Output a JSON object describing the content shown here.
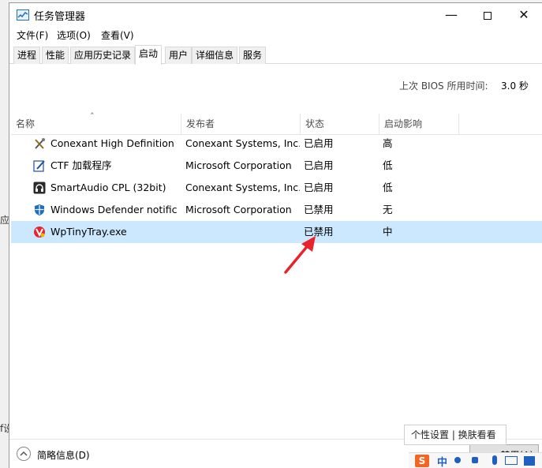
{
  "window": {
    "title": "任务管理器"
  },
  "menu": {
    "file": "文件(F)",
    "options": "选项(O)",
    "view": "查看(V)"
  },
  "tabs": [
    {
      "label": "进程",
      "active": false
    },
    {
      "label": "性能",
      "active": false
    },
    {
      "label": "应用历史记录",
      "active": false
    },
    {
      "label": "启动",
      "active": true
    },
    {
      "label": "用户",
      "active": false
    },
    {
      "label": "详细信息",
      "active": false
    },
    {
      "label": "服务",
      "active": false
    }
  ],
  "bios": {
    "label": "上次 BIOS 所用时间:",
    "value": "3.0 秒"
  },
  "columns": {
    "name": "名称",
    "publisher": "发布者",
    "status": "状态",
    "impact": "启动影响"
  },
  "rows": [
    {
      "icon": "conexant-tools-icon",
      "name": "Conexant High Definition ...",
      "publisher": "Conexant Systems, Inc.",
      "status": "已启用",
      "impact": "高",
      "selected": false
    },
    {
      "icon": "ctf-pen-icon",
      "name": "CTF 加载程序",
      "publisher": "Microsoft Corporation",
      "status": "已启用",
      "impact": "低",
      "selected": false
    },
    {
      "icon": "smartaudio-headset-icon",
      "name": "SmartAudio CPL (32bit)",
      "publisher": "Conexant Systems, Inc.",
      "status": "已启用",
      "impact": "低",
      "selected": false
    },
    {
      "icon": "windows-defender-shield-icon",
      "name": "Windows Defender notific...",
      "publisher": "Microsoft Corporation",
      "status": "已禁用",
      "impact": "无",
      "selected": false
    },
    {
      "icon": "wptinytray-icon",
      "name": "WpTinyTray.exe",
      "publisher": "",
      "status": "已禁用",
      "impact": "中",
      "selected": true
    }
  ],
  "bottom": {
    "fewer_details": "简略信息(D)",
    "disable_button": "禁用(A)"
  },
  "overlay": {
    "watermark": "个性设置 | 换肤看看",
    "ime_logo": "S",
    "ime_lang": "中"
  },
  "background": {
    "frag1": "应月",
    "frag2": "f设"
  },
  "colors": {
    "selected_row": "#cce8ff",
    "annotation_arrow": "#e8232b",
    "ime_accent": "#f26522"
  }
}
